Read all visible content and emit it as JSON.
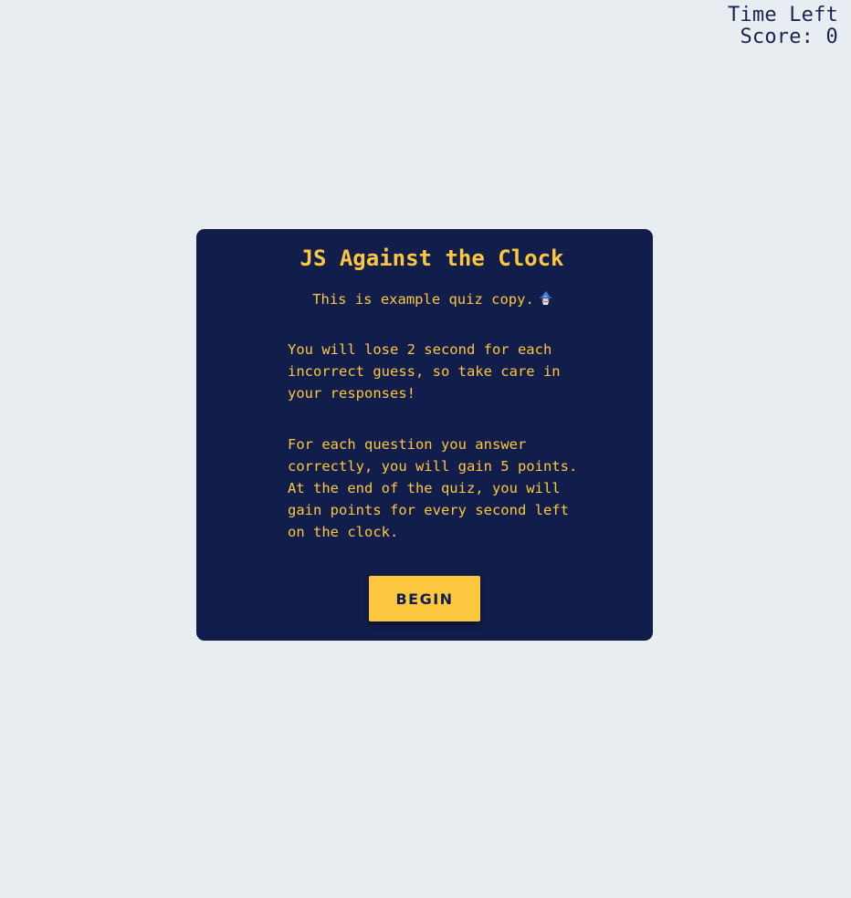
{
  "hud": {
    "time_left_label": "Time Left",
    "score_text": "Score: 0"
  },
  "quiz": {
    "title": "JS Against the Clock",
    "intro_text": "This is example quiz copy.",
    "intro_icon": "wizard-emoji-icon",
    "paragraph_1": "You will lose 2 second for each incorrect guess, so take care in your responses!",
    "paragraph_2": "For each question you answer correctly, you will gain 5 points. At the end of the quiz, you will gain points for every second left on the clock.",
    "begin_label": "BEGIN"
  },
  "colors": {
    "background": "#e8edf2",
    "card": "#111d4a",
    "accent": "#fec740",
    "hud_text": "#1a2250"
  }
}
